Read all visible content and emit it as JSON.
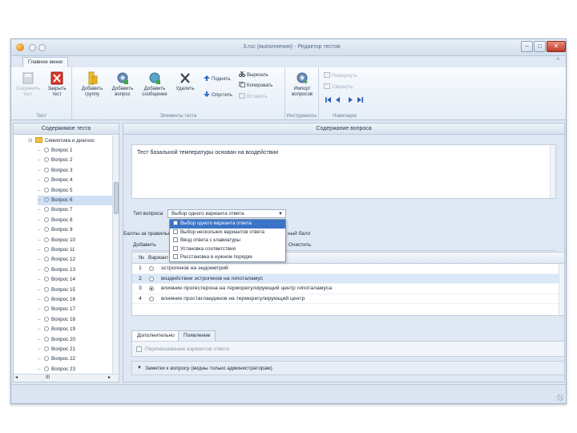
{
  "window": {
    "title": "3.ruc (выполнения) - Редактор тестов",
    "controls": {
      "minimize": "–",
      "maximize": "□",
      "close": "✕"
    }
  },
  "ribbon": {
    "tab": "Главное меню",
    "collapse_glyph": "^",
    "groups": {
      "test": {
        "label": "Тест",
        "buttons": [
          {
            "label": "Сохранить\nтест",
            "icon": "save-icon",
            "enabled": false
          },
          {
            "label": "Закрыть\nтест",
            "icon": "close-test-icon",
            "enabled": true
          }
        ]
      },
      "test_elements": {
        "label": "Элементы теста",
        "buttons": [
          {
            "label": "Добавить\nгруппу",
            "icon": "add-group-icon"
          },
          {
            "label": "Добавить\nвопрос",
            "icon": "add-question-icon"
          },
          {
            "label": "Добавить\nсообщение",
            "icon": "add-message-icon"
          },
          {
            "label": "Удалить",
            "icon": "delete-icon"
          }
        ],
        "small": [
          {
            "label": "Поднять",
            "icon": "arrow-up-icon"
          },
          {
            "label": "Опустить",
            "icon": "arrow-down-icon"
          },
          {
            "label": "Вырезать",
            "icon": "cut-icon"
          },
          {
            "label": "Копировать",
            "icon": "copy-icon"
          },
          {
            "label": "Вставить",
            "icon": "paste-icon",
            "enabled": false
          }
        ]
      },
      "tools": {
        "label": "Инструменты",
        "buttons": [
          {
            "label": "Импорт\nвопросов",
            "icon": "import-icon"
          }
        ]
      },
      "navigation": {
        "label": "Навигация",
        "small": [
          {
            "label": "Развернуть",
            "enabled": false
          },
          {
            "label": "Свернуть",
            "enabled": false
          }
        ],
        "arrows": [
          "first-icon",
          "prev-icon",
          "next-icon",
          "last-icon"
        ]
      }
    }
  },
  "left_pane": {
    "title": "Содержимое теста",
    "root": "Семиотика и диагнос",
    "questions": [
      "Вопрос 1",
      "Вопрос 2",
      "Вопрос 3",
      "Вопрос 4",
      "Вопрос 5",
      "Вопрос 6",
      "Вопрос 7",
      "Вопрос 8",
      "Вопрос 9",
      "Вопрос 10",
      "Вопрос 11",
      "Вопрос 12",
      "Вопрос 13",
      "Вопрос 14",
      "Вопрос 15",
      "Вопрос 16",
      "Вопрос 17",
      "Вопрос 18",
      "Вопрос 19",
      "Вопрос 20",
      "Вопрос 21",
      "Вопрос 22",
      "Вопрос 23"
    ],
    "selected_index": 5,
    "hscroll_value": "III"
  },
  "right_pane": {
    "title": "Содержание вопроса",
    "question_text": "Тест базальной температуры основан на воздействии",
    "type_label": "Тип вопроса",
    "type_value": "Выбор одного варианта ответа",
    "type_options": [
      "Выбор одного варианта ответа",
      "Выбор нескольких вариантов ответа",
      "Ввод ответа с клавиатуры",
      "Установка соответствия",
      "Расстановка в нужном порядке"
    ],
    "score_label": "Баллы за правильный ответ",
    "score_hint": "ный балл",
    "add_label": "Добавить",
    "clear_label": "Очистить",
    "grid_headers": [
      "№",
      "Вариант"
    ],
    "answers": [
      {
        "num": "1",
        "text": "эстрогенов на эндометрий",
        "correct": false
      },
      {
        "num": "2",
        "text": "воздействии эстрогенов на гипоталамус",
        "correct": false
      },
      {
        "num": "3",
        "text": "влияние прогестерона на терморегулирующий центр гипоталамуса",
        "correct": true
      },
      {
        "num": "4",
        "text": "влияние простагландинов на терморегулирующий центр",
        "correct": false
      }
    ],
    "tabs": [
      "Дополнительно",
      "Появление"
    ],
    "shuffle_label": "Перемешивание вариантов ответа",
    "notes_label": "Заметки к вопросу (видны только администраторам)"
  },
  "colors": {
    "chrome": "#dfe8f3",
    "selection": "#3a74c8",
    "close_button": "#c0392b"
  }
}
